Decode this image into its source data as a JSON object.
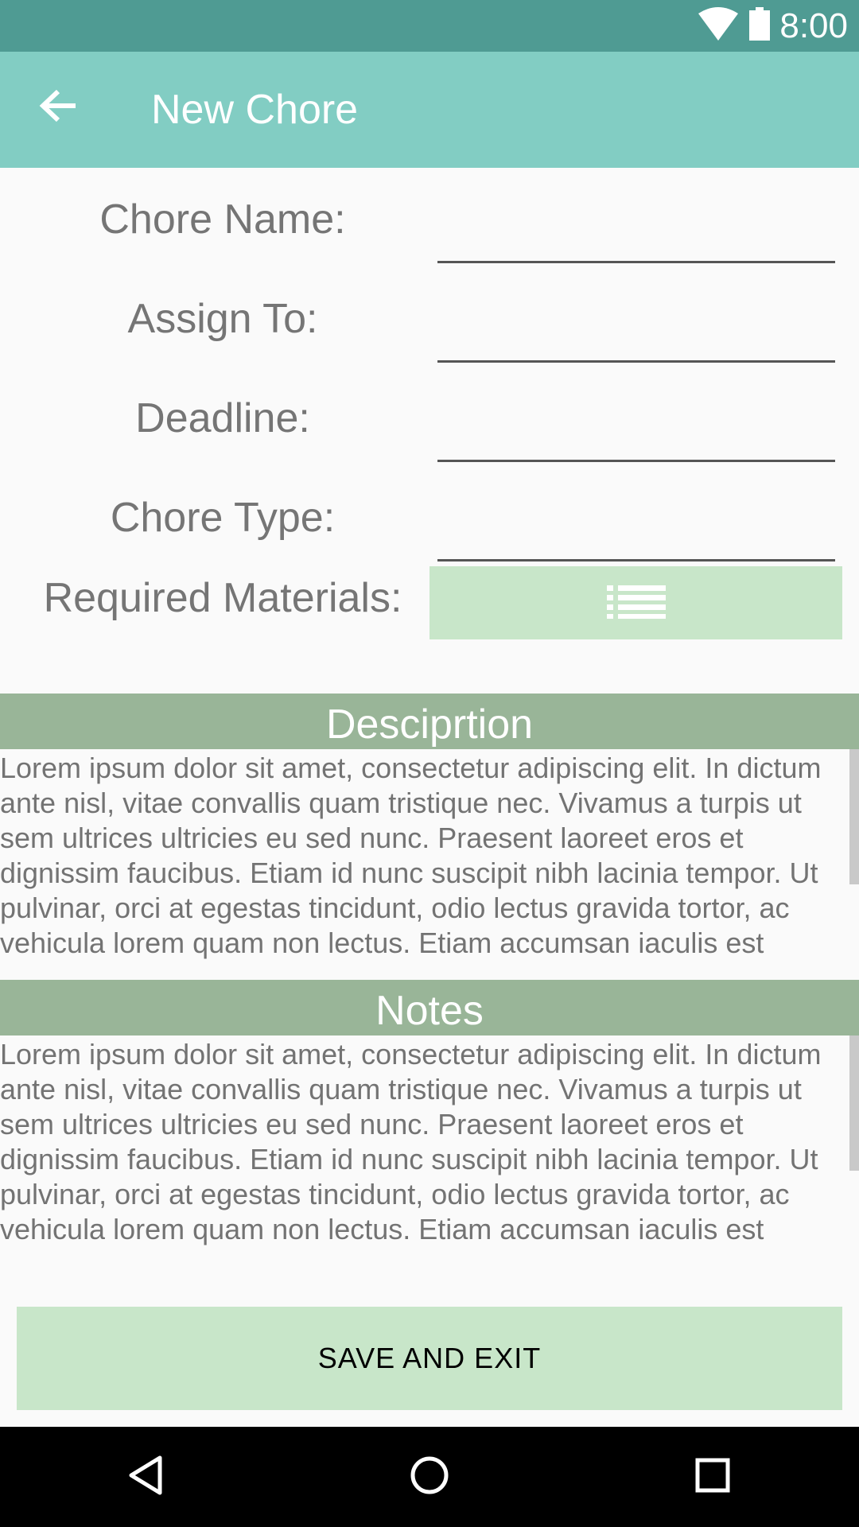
{
  "status_bar": {
    "time": "8:00",
    "icons": [
      "wifi-icon",
      "battery-icon"
    ]
  },
  "app_bar": {
    "title": "New Chore",
    "back_icon": "arrow-back-icon"
  },
  "form": {
    "chore_name": {
      "label": "Chore Name:",
      "value": ""
    },
    "assign_to": {
      "label": "Assign To:",
      "value": ""
    },
    "deadline": {
      "label": "Deadline:",
      "value": ""
    },
    "chore_type": {
      "label": "Chore Type:",
      "value": ""
    },
    "required_materials": {
      "label": "Required Materials:",
      "icon": "list-icon"
    }
  },
  "description": {
    "header": "Desciprtion",
    "text": "Lorem ipsum dolor sit amet, consectetur adipiscing elit. In dictum ante nisl, vitae convallis quam tristique nec. Vivamus a turpis ut sem ultrices ultricies eu sed nunc. Praesent laoreet eros et dignissim faucibus. Etiam id nunc suscipit nibh lacinia tempor. Ut pulvinar, orci at egestas tincidunt, odio lectus gravida tortor, ac vehicula lorem quam non lectus. Etiam accumsan iaculis est"
  },
  "notes": {
    "header": "Notes",
    "text": "Lorem ipsum dolor sit amet, consectetur adipiscing elit. In dictum ante nisl, vitae convallis quam tristique nec. Vivamus a turpis ut sem ultrices ultricies eu sed nunc. Praesent laoreet eros et dignissim faucibus. Etiam id nunc suscipit nibh lacinia tempor. Ut pulvinar, orci at egestas tincidunt, odio lectus gravida tortor, ac vehicula lorem quam non lectus. Etiam accumsan iaculis est"
  },
  "save_button": {
    "label": "SAVE AND EXIT"
  },
  "nav_bar": {
    "icons": [
      "back-triangle-icon",
      "home-circle-icon",
      "recents-square-icon"
    ]
  },
  "colors": {
    "status_bar": "#4f9b93",
    "app_bar": "#82cdc3",
    "section_header": "#99b598",
    "button": "#c8e6c9"
  }
}
